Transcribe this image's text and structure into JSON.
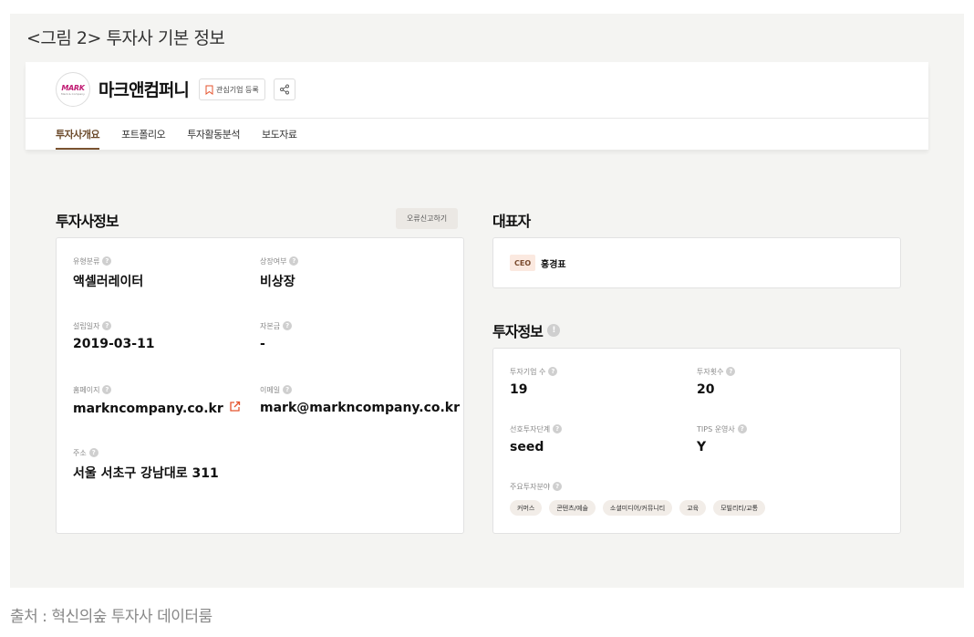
{
  "figure_caption": "<그림 2> 투자사 기본 정보",
  "source": "출처 : 혁신의숲 투자사 데이터룸",
  "company": {
    "logo_text": "MARK",
    "logo_subtext": "Mark & Company",
    "name": "마크앤컴퍼니",
    "watch_label": "관심기업 등록",
    "share_icon": "share-icon"
  },
  "tabs": [
    "투자사개요",
    "포트폴리오",
    "투자활동분석",
    "보도자료"
  ],
  "active_tab": 0,
  "investor_info": {
    "title": "투자사정보",
    "error_report": "오류신고하기",
    "fields": [
      {
        "label": "유형분류",
        "value": "액셀러레이터"
      },
      {
        "label": "상장여부",
        "value": "비상장"
      },
      {
        "label": "설립일자",
        "value": "2019-03-11"
      },
      {
        "label": "자본금",
        "value": "-"
      },
      {
        "label": "홈페이지",
        "value": "markncompany.co.kr"
      },
      {
        "label": "이메일",
        "value": "mark@markncompany.co.kr"
      },
      {
        "label": "주소",
        "value": "서울 서초구 강남대로 311"
      }
    ]
  },
  "ceo": {
    "title": "대표자",
    "tag": "CEO",
    "name": "홍경표"
  },
  "investment_info": {
    "title": "투자정보",
    "fields": [
      {
        "label": "투자기업 수",
        "value": "19"
      },
      {
        "label": "투자횟수",
        "value": "20"
      },
      {
        "label": "선호투자단계",
        "value": "seed"
      },
      {
        "label": "TIPS 운영사",
        "value": "Y"
      }
    ],
    "focus_label": "주요투자분야",
    "focus_areas": [
      "커머스",
      "콘텐츠/예술",
      "소셜미디어/커뮤니티",
      "교육",
      "모빌리티/교통"
    ]
  },
  "colors": {
    "accent_brown": "#7a5230",
    "ceo_tag_bg": "#fbe9e0",
    "link_icon": "#e5532d",
    "logo_magenta": "#c01a72"
  }
}
